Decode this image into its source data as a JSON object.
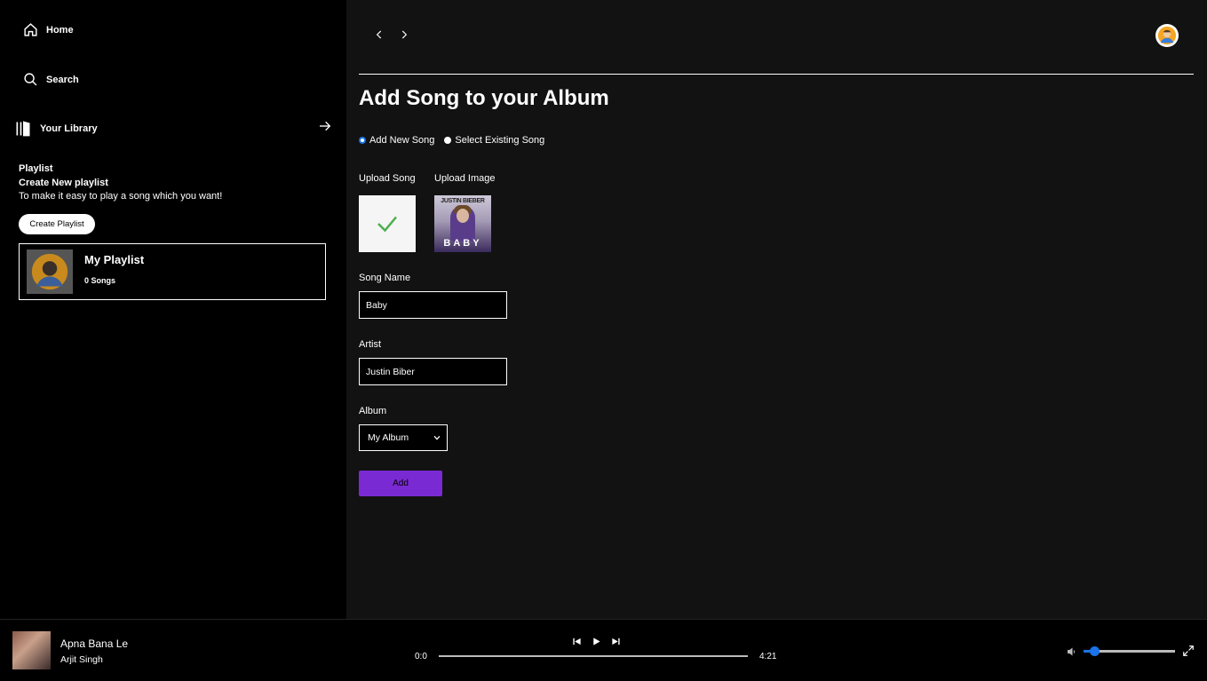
{
  "sidebar": {
    "home_label": "Home",
    "search_label": "Search",
    "library_label": "Your Library",
    "playlist_section": {
      "title": "Playlist",
      "subtitle": "Create New playlist",
      "description": "To make it easy to play a song which you want!",
      "create_button": "Create Playlist"
    },
    "playlists": [
      {
        "name": "My Playlist",
        "count": "0 Songs"
      }
    ]
  },
  "main": {
    "title": "Add Song to your Album",
    "radio_options": [
      {
        "label": "Add New Song",
        "checked": true
      },
      {
        "label": "Select Existing Song",
        "checked": false
      }
    ],
    "upload_song_label": "Upload Song",
    "upload_image_label": "Upload Image",
    "image_cover": {
      "top_text": "JUSTIN BIEBER",
      "bottom_text": "BABY"
    },
    "song_name_label": "Song Name",
    "song_name_value": "Baby",
    "artist_label": "Artist",
    "artist_value": "Justin Biber",
    "album_label": "Album",
    "album_value": "My Album",
    "add_button": "Add"
  },
  "player": {
    "title": "Apna Bana Le",
    "artist": "Arjit Singh",
    "current_time": "0:0",
    "total_time": "4:21",
    "progress": 0,
    "volume": 0.12
  },
  "colors": {
    "accent": "#7a2ad3",
    "slider": "#1a73e8",
    "check": "#4caf50"
  }
}
